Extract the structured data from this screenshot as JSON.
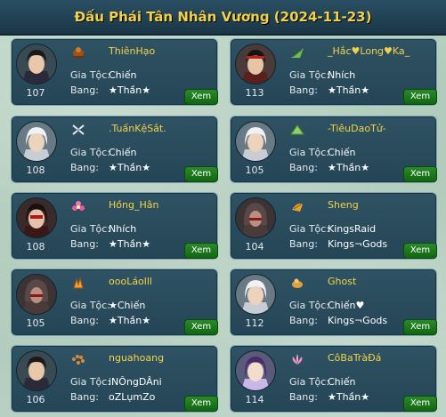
{
  "title": "Đấu Phái Tân Nhân Vương (2024-11-23)",
  "labels": {
    "clan": "Gia Tộc:",
    "gang": "Bang:",
    "view": "Xem"
  },
  "players": [
    {
      "name": "ThiênHạo",
      "level": "107",
      "clan": "Chiến",
      "gang": "★Thần★",
      "faction_icon": "beetle-icon",
      "portrait": "dark-hair-male-warrior"
    },
    {
      "name": "_Hắc♥Long♥Ka_",
      "level": "113",
      "clan": "Nhích",
      "gang": "★Thần★",
      "faction_icon": "bamboo-leaf-icon",
      "portrait": "black-hair-male-red-headband"
    },
    {
      "name": ".TuấnKệSắt.",
      "level": "108",
      "clan": "Chiến",
      "gang": "★Thần★",
      "faction_icon": "crossed-blades-icon",
      "portrait": "white-hair-male"
    },
    {
      "name": "-TiêuDaoTử-",
      "level": "105",
      "clan": "Chiến",
      "gang": "★Thần★",
      "faction_icon": "green-fan-icon",
      "portrait": "white-hair-male"
    },
    {
      "name": "Hồng_Hân",
      "level": "108",
      "clan": "Nhích",
      "gang": "★Thần★",
      "faction_icon": "flower-icon",
      "portrait": "red-mask-female"
    },
    {
      "name": "Sheng",
      "level": "104",
      "clan": "KingsRaid",
      "gang": "Kings¬Gods",
      "faction_icon": "gold-scroll-icon",
      "portrait": "hooded-assassin"
    },
    {
      "name": "oooLáolll",
      "level": "105",
      "clan": "★Chiến",
      "gang": "★Thần★",
      "faction_icon": "flame-claw-icon",
      "portrait": "hooded-assassin"
    },
    {
      "name": "Ghost",
      "level": "112",
      "clan": "Chiến♥",
      "gang": "Kings¬Gods",
      "faction_icon": "gourd-icon",
      "portrait": "white-hair-male"
    },
    {
      "name": "nguahoang",
      "level": "106",
      "clan": "iNÔngDÂni",
      "gang": "oZLụmZo",
      "faction_icon": "prayer-beads-icon",
      "portrait": "dark-hair-male-warrior"
    },
    {
      "name": "CôBaTràĐá",
      "level": "114",
      "clan": "Chiến",
      "gang": "★Thần★",
      "faction_icon": "lotus-icon",
      "portrait": "purple-hair-female"
    }
  ]
}
